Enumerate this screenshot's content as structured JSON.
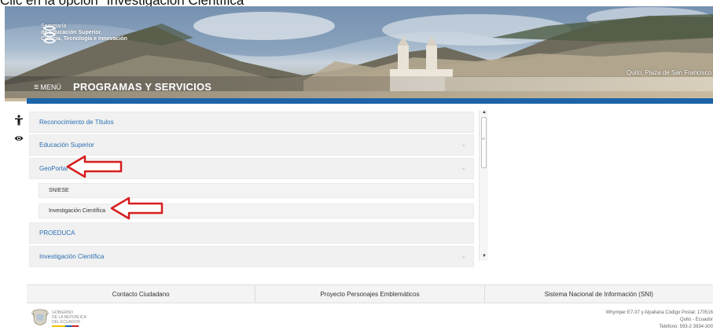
{
  "caption": "Clic en la opción \"Investigación Científica\"",
  "header": {
    "logo_line1": "Secretaría",
    "logo_line2": "de Educación Superior,",
    "logo_line3": "Ciencia, Tecnología e Innovación",
    "photo_credit": "Quito, Plaza de San Francisco",
    "menu_label": "MENÚ",
    "page_title": "PROGRAMAS Y SERVICIOS"
  },
  "icons": {
    "accessibility": "accessibility-icon",
    "visibility": "eye-icon"
  },
  "accordion": {
    "items": [
      {
        "label": "Reconocimiento de Títulos",
        "expanded": false
      },
      {
        "label": "Educación Superior",
        "expanded": false
      },
      {
        "label": "GeoPortal",
        "expanded": true
      },
      {
        "label": "SNIESE",
        "sub": true
      },
      {
        "label": "Investigación Científica",
        "sub": true
      },
      {
        "label": "PROEDUCA",
        "expanded": false
      },
      {
        "label": "Investigación Científica",
        "expanded": false
      }
    ]
  },
  "annotations": {
    "arrow_color": "#d71e1e"
  },
  "footer": {
    "links": [
      "Contacto Ciudadano",
      "Proyecto Personajes Emblemáticos",
      "Sistema Nacional de Información (SNI)"
    ],
    "gov_line1": "GOBIERNO",
    "gov_line2": "DE LA REPÚBLICA",
    "gov_line3": "DEL ECUADOR",
    "address_line1": "Whymper E7-37 y Alpallana Código Postal: 170516",
    "address_line2": "Quito - Ecuador",
    "address_line3": "Teléfono: 593-2 3934-300"
  },
  "colors": {
    "accent_blue": "#1c63a7",
    "link_blue": "#2a6fb3"
  }
}
